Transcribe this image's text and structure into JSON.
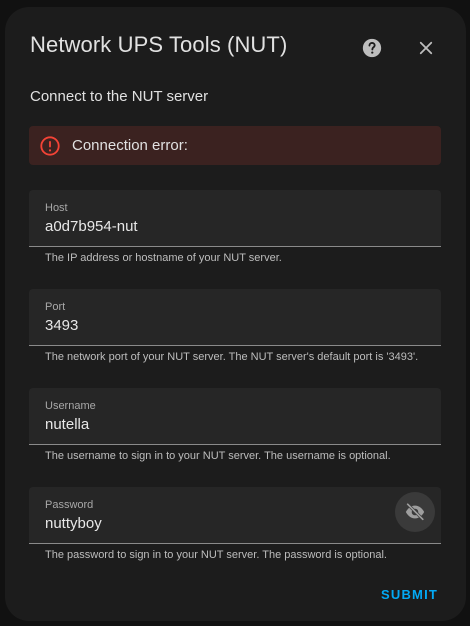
{
  "dialog": {
    "title": "Network UPS Tools (NUT)",
    "subtitle": "Connect to the NUT server",
    "help_icon": "help-circle-icon",
    "close_icon": "close-icon"
  },
  "alert": {
    "icon": "alert-circle-icon",
    "message": "Connection error:",
    "color": "#f44336"
  },
  "fields": {
    "host": {
      "label": "Host",
      "value": "a0d7b954-nut",
      "helper": "The IP address or hostname of your NUT server."
    },
    "port": {
      "label": "Port",
      "value": "3493",
      "helper": "The network port of your NUT server. The NUT server's default port is '3493'."
    },
    "username": {
      "label": "Username",
      "value": "nutella",
      "helper": "The username to sign in to your NUT server. The username is optional."
    },
    "password": {
      "label": "Password",
      "value": "nuttyboy",
      "helper": "The password to sign in to your NUT server. The password is optional.",
      "toggle_icon": "eye-off-icon"
    }
  },
  "actions": {
    "submit_label": "SUBMIT",
    "accent": "#03a9f4"
  }
}
